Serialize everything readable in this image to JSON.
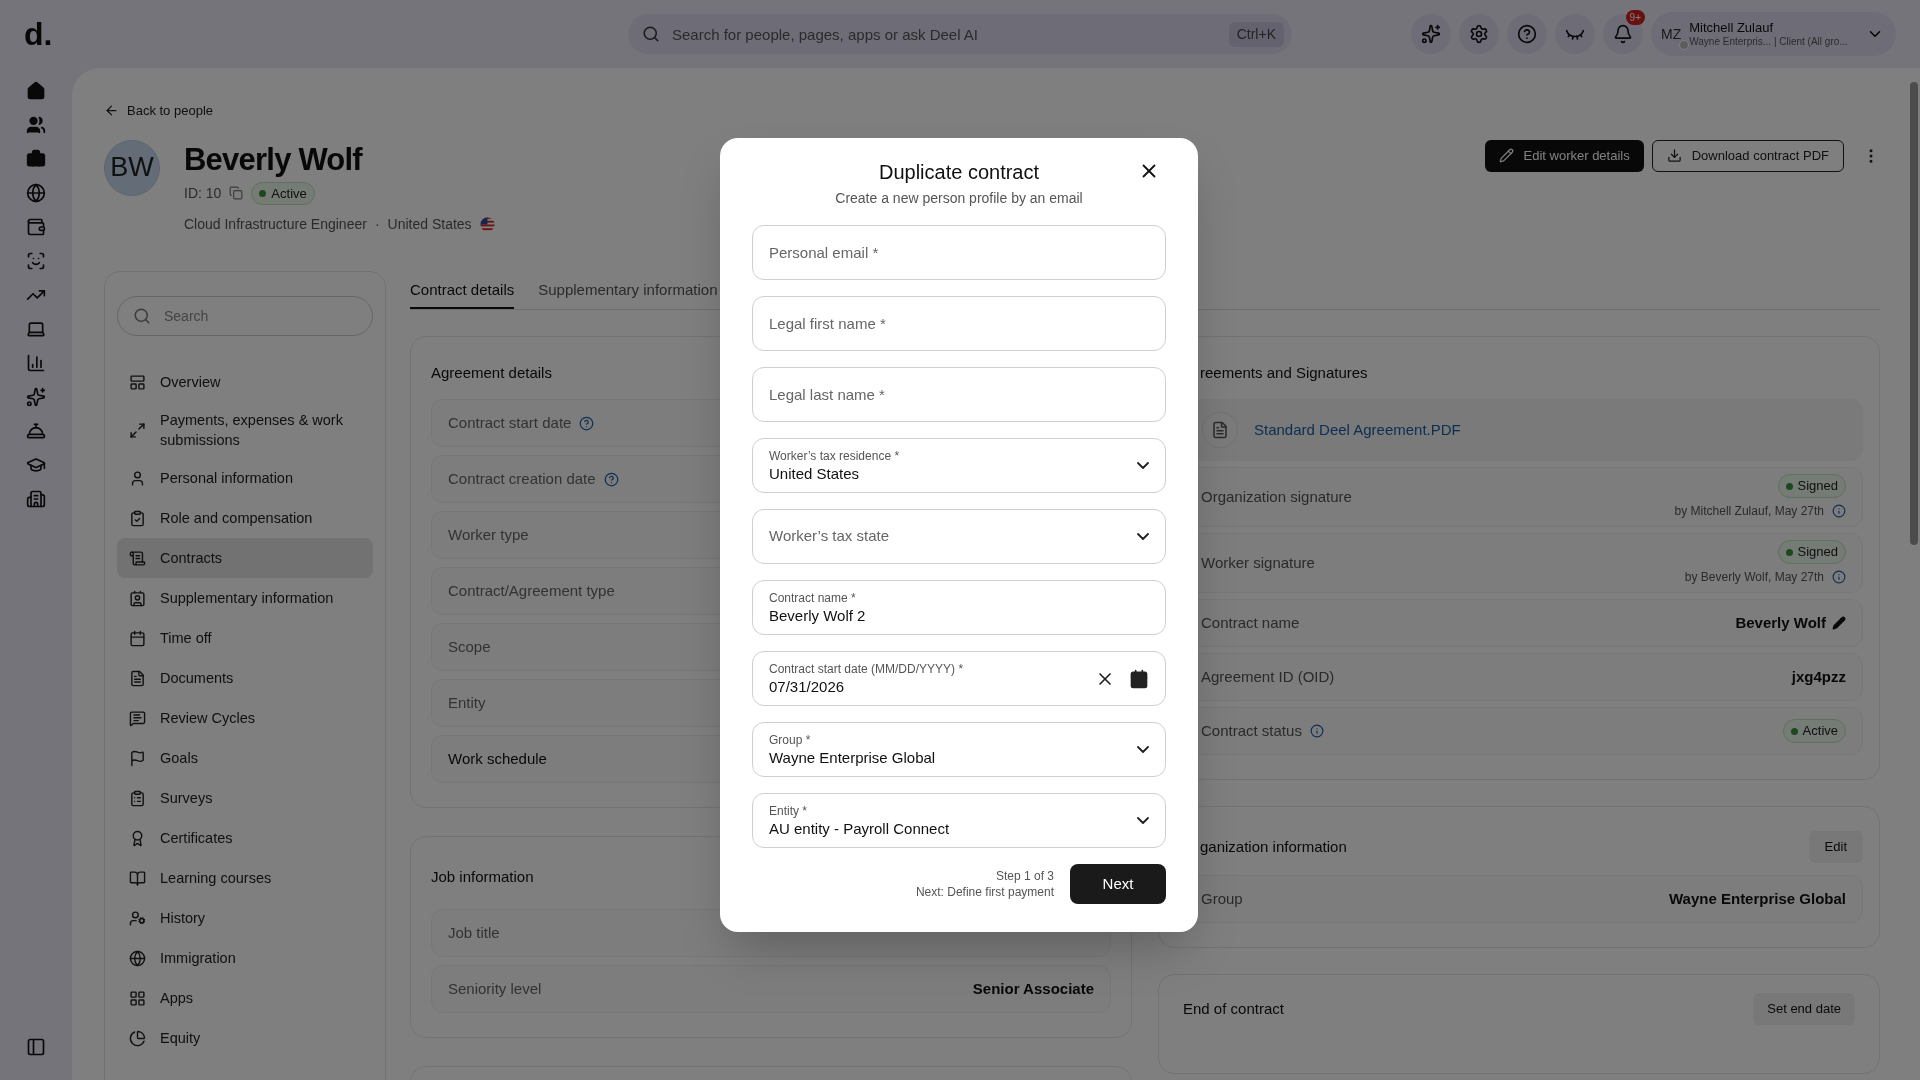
{
  "top_bar": {
    "logo": "d.",
    "search": {
      "placeholder": "Search for people, pages, apps or ask Deel AI",
      "shortcut": "Ctrl+K"
    },
    "notifications_badge": "9+",
    "user": {
      "initials": "MZ",
      "name": "Mitchell Zulauf",
      "subtitle": "Wayne Enterpris... | Client (All gro..."
    }
  },
  "back_link": "Back to people",
  "profile": {
    "initials": "BW",
    "name": "Beverly Wolf",
    "id": "ID: 10",
    "status": "Active",
    "job": "Cloud Infrastructure Engineer",
    "separator": "·",
    "country": "United States"
  },
  "actions": [
    "Edit worker details",
    "Download contract PDF"
  ],
  "nav": {
    "search_placeholder": "Search",
    "items": [
      {
        "label": "Overview",
        "selected": false
      },
      {
        "label": "Payments, expenses & work submissions",
        "selected": false
      },
      {
        "label": "Personal information",
        "selected": false
      },
      {
        "label": "Role and compensation",
        "selected": false
      },
      {
        "label": "Contracts",
        "selected": true
      },
      {
        "label": "Supplementary information",
        "selected": false
      },
      {
        "label": "Time off",
        "selected": false
      },
      {
        "label": "Documents",
        "selected": false
      },
      {
        "label": "Review Cycles",
        "selected": false
      },
      {
        "label": "Goals",
        "selected": false
      },
      {
        "label": "Surveys",
        "selected": false
      },
      {
        "label": "Certificates",
        "selected": false
      },
      {
        "label": "Learning courses",
        "selected": false
      },
      {
        "label": "History",
        "selected": false
      },
      {
        "label": "Immigration",
        "selected": false
      },
      {
        "label": "Apps",
        "selected": false
      },
      {
        "label": "Equity",
        "selected": false
      }
    ]
  },
  "tabs": [
    {
      "label": "Contract details",
      "selected": true
    },
    {
      "label": "Supplementary information",
      "selected": false
    }
  ],
  "agreement_details": {
    "title": "Agreement details",
    "rows": [
      {
        "label": "Contract start date",
        "help": true,
        "muted": true
      },
      {
        "label": "Contract creation date",
        "help": true,
        "muted": true
      },
      {
        "label": "Worker type",
        "help": false,
        "muted": true
      },
      {
        "label": "Contract/Agreement type",
        "help": false,
        "muted": true
      },
      {
        "label": "Scope",
        "help": false,
        "muted": true
      },
      {
        "label": "Entity",
        "help": false,
        "muted": true
      },
      {
        "label": "Work schedule",
        "help": false,
        "muted": false
      }
    ]
  },
  "job_information": {
    "title": "Job information",
    "rows": [
      {
        "label": "Job title"
      },
      {
        "label": "Seniority level",
        "value": "Senior Associate"
      }
    ]
  },
  "agreements": {
    "title": "reements and Signatures",
    "document": "Standard Deel Agreement.PDF",
    "signatures": [
      {
        "label": "Organization signature",
        "status": "Signed",
        "by": "by Mitchell Zulauf, May 27th"
      },
      {
        "label": "Worker signature",
        "status": "Signed",
        "by": "by Beverly Wolf, May 27th"
      }
    ],
    "rows": [
      {
        "label": "Contract name",
        "value": "Beverly Wolf",
        "kind": "editable"
      },
      {
        "label": "Agreement ID (OID)",
        "value": "jxg4pzz",
        "kind": "text"
      },
      {
        "label": "Contract status",
        "value": "Active",
        "kind": "badge"
      }
    ]
  },
  "organization": {
    "title": "ganization information",
    "button": "Edit",
    "rows": [
      {
        "label": "Group",
        "value": "Wayne Enterprise Global"
      }
    ]
  },
  "end_of_contract": {
    "title": "End of contract",
    "button": "Set end date"
  },
  "modal": {
    "title": "Duplicate contract",
    "subtitle": "Create a new person profile by an email",
    "fields": [
      {
        "kind": "text",
        "placeholder": "Personal email *"
      },
      {
        "kind": "text",
        "placeholder": "Legal first name *"
      },
      {
        "kind": "text",
        "placeholder": "Legal last name *"
      },
      {
        "kind": "select",
        "label": "Worker’s tax residence *",
        "value": "United States"
      },
      {
        "kind": "select",
        "placeholder": "Worker’s tax state"
      },
      {
        "kind": "text",
        "label": "Contract name *",
        "value": "Beverly Wolf 2"
      },
      {
        "kind": "date",
        "label": "Contract start date (MM/DD/YYYY) *",
        "value": "07/31/2026"
      },
      {
        "kind": "select",
        "label": "Group *",
        "value": "Wayne Enterprise Global"
      },
      {
        "kind": "select",
        "label": "Entity *",
        "value": "AU entity - Payroll Connect"
      }
    ],
    "step": "Step 1 of 3",
    "next_hint": "Next: Define first payment",
    "next_button": "Next"
  }
}
